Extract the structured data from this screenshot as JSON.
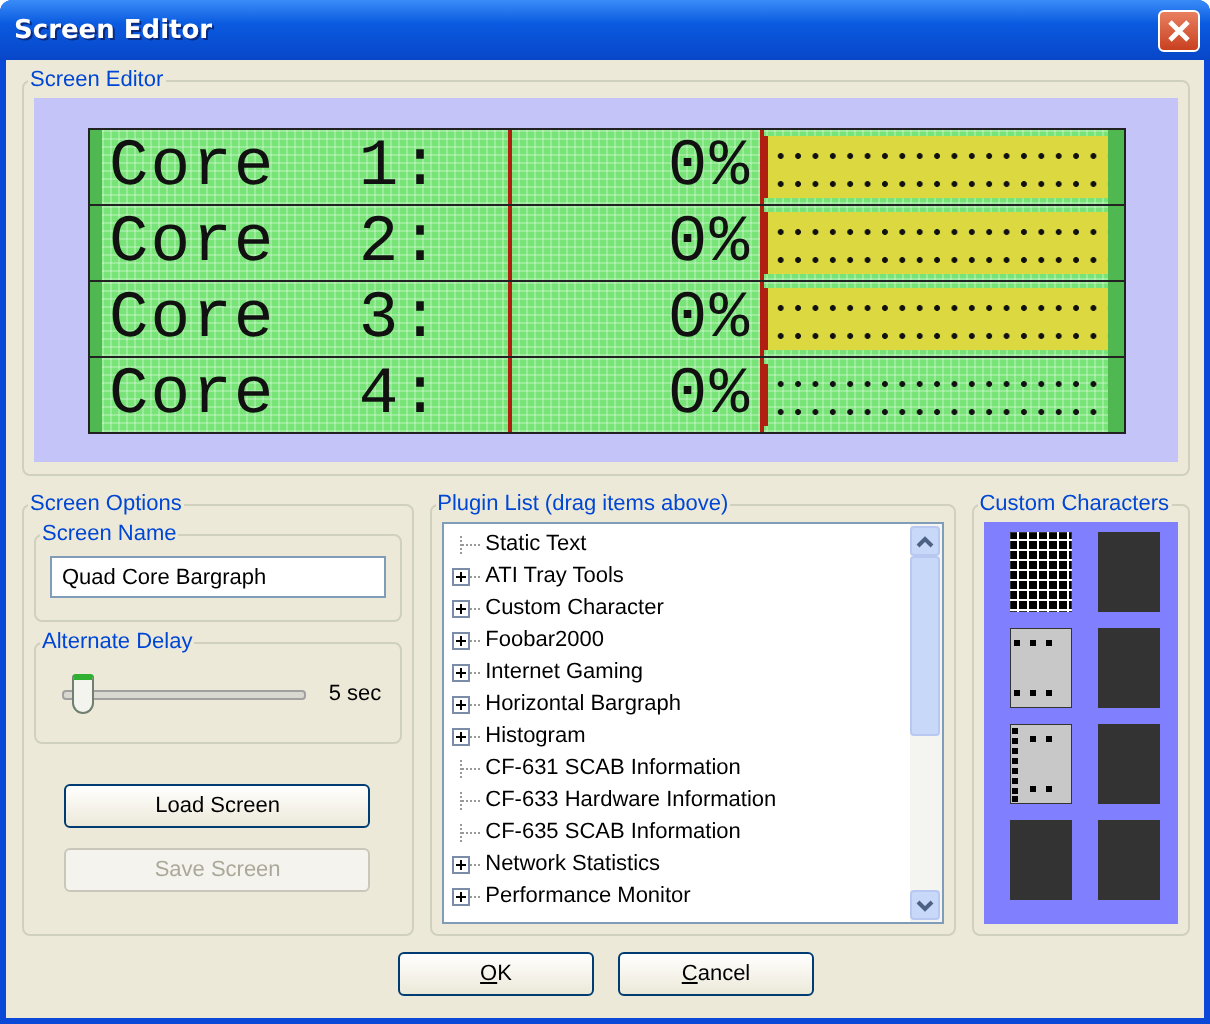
{
  "window": {
    "title": "Screen Editor"
  },
  "screen_editor": {
    "title": "Screen Editor",
    "lcd_rows": [
      {
        "label": "Core  1:",
        "value": "0%",
        "highlighted": true
      },
      {
        "label": "Core  2:",
        "value": "0%",
        "highlighted": true
      },
      {
        "label": "Core  3:",
        "value": "0%",
        "highlighted": true
      },
      {
        "label": "Core  4:",
        "value": "0%",
        "highlighted": false
      }
    ]
  },
  "screen_options": {
    "title": "Screen Options",
    "screen_name": {
      "label": "Screen Name",
      "value": "Quad Core Bargraph"
    },
    "alternate_delay": {
      "label": "Alternate Delay",
      "level": 0.07,
      "reading": "5 sec"
    },
    "buttons": [
      {
        "label": "Load Screen",
        "disabled": false
      },
      {
        "label": "Save Screen",
        "disabled": true
      }
    ]
  },
  "plugin_list": {
    "title": "Plugin List (drag items above)",
    "items": [
      {
        "label": "Static Text",
        "expandable": false
      },
      {
        "label": "ATI Tray Tools",
        "expandable": true
      },
      {
        "label": "Custom Character",
        "expandable": true
      },
      {
        "label": "Foobar2000",
        "expandable": true
      },
      {
        "label": "Internet Gaming",
        "expandable": true
      },
      {
        "label": "Horizontal Bargraph",
        "expandable": true
      },
      {
        "label": "Histogram",
        "expandable": true
      },
      {
        "label": "CF-631 SCAB Information",
        "expandable": false
      },
      {
        "label": "CF-633 Hardware Information",
        "expandable": false
      },
      {
        "label": "CF-635 SCAB Information",
        "expandable": false
      },
      {
        "label": "Network Statistics",
        "expandable": true
      },
      {
        "label": "Performance Monitor",
        "expandable": true
      }
    ]
  },
  "custom_characters": {
    "title": "Custom Characters",
    "chars": [
      {
        "kind": "grid"
      },
      {
        "kind": "blank"
      },
      {
        "kind": "dots"
      },
      {
        "kind": "blank"
      },
      {
        "kind": "dots_left"
      },
      {
        "kind": "blank"
      },
      {
        "kind": "blank"
      },
      {
        "kind": "blank"
      }
    ]
  },
  "dialog_buttons": [
    "OK",
    "Cancel"
  ]
}
